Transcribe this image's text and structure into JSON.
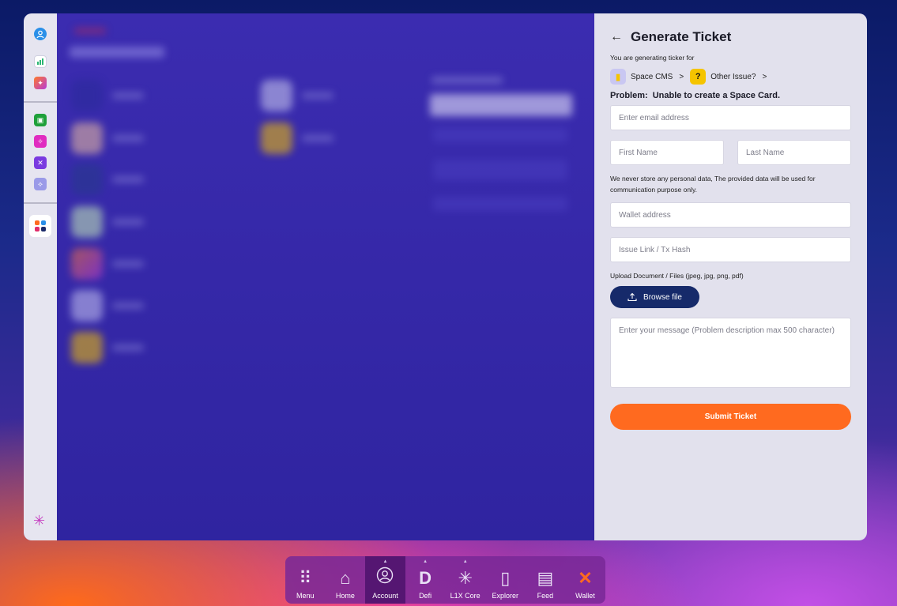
{
  "panel": {
    "title": "Generate Ticket",
    "sub_note": "You are generating ticker for",
    "crumbs": [
      {
        "label": "Space CMS",
        "icon": "space-cms-icon",
        "color": "#c9c7f2"
      },
      {
        "label": "Other Issue?",
        "icon": "question-icon",
        "color": "#f5c400"
      }
    ],
    "crumb_separator": ">",
    "problem_label": "Problem:",
    "problem_text": "Unable to create a Space Card.",
    "email_placeholder": "Enter email address",
    "first_name_placeholder": "First Name",
    "last_name_placeholder": "Last Name",
    "privacy_note": "We never store any personal data, The provided data will be used for communication purpose only.",
    "wallet_placeholder": "Wallet address",
    "issue_link_placeholder": "Issue Link / Tx Hash",
    "upload_label": "Upload Document / Files (jpeg, jpg, png, pdf)",
    "browse_label": "Browse file",
    "message_placeholder": "Enter your message (Problem description max 500 character)",
    "submit_label": "Submit Ticket"
  },
  "dock": {
    "items": [
      {
        "label": "Menu",
        "icon": "grid-icon"
      },
      {
        "label": "Home",
        "icon": "home-icon"
      },
      {
        "label": "Account",
        "icon": "account-icon",
        "active": true
      },
      {
        "label": "Defi",
        "icon": "defi-icon"
      },
      {
        "label": "L1X Core",
        "icon": "l1x-core-icon"
      },
      {
        "label": "Explorer",
        "icon": "explorer-icon"
      },
      {
        "label": "Feed",
        "icon": "feed-icon"
      },
      {
        "label": "Wallet",
        "icon": "wallet-icon"
      }
    ]
  },
  "colors": {
    "accent": "#ff6a1f",
    "browse_button": "#162a6a",
    "panel_bg": "#e2e1ed"
  }
}
